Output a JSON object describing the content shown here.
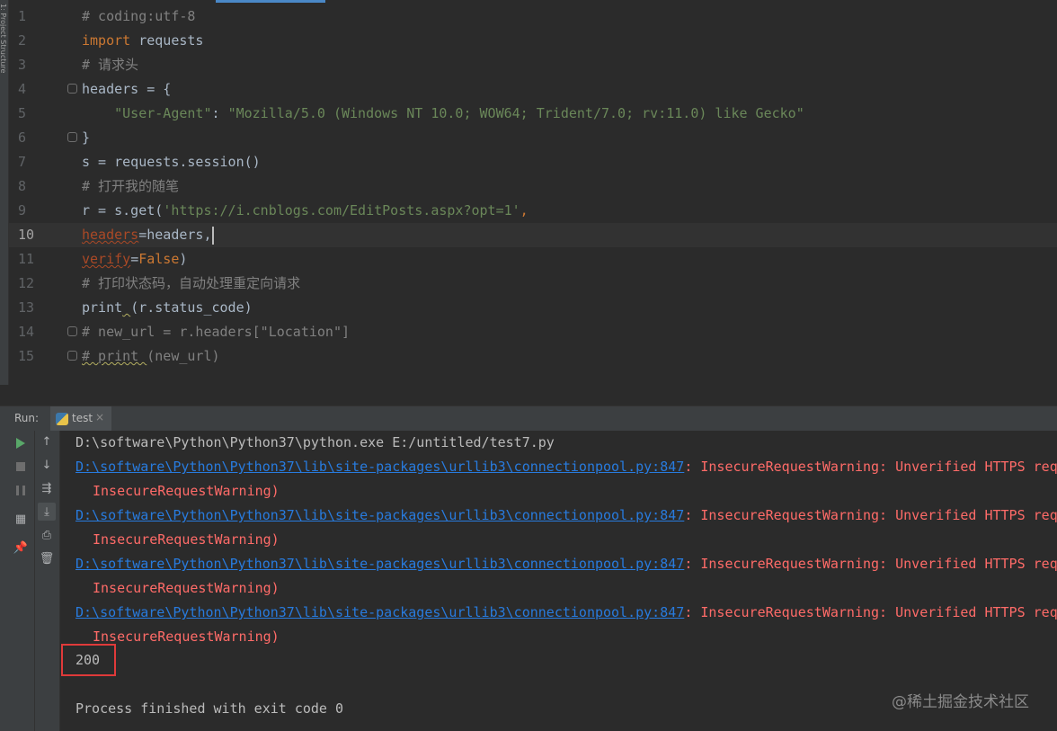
{
  "editor": {
    "side_tool_label": "1: Project  Structure",
    "line_numbers": [
      "1",
      "2",
      "3",
      "4",
      "5",
      "6",
      "7",
      "8",
      "9",
      "10",
      "11",
      "12",
      "13",
      "14",
      "15"
    ],
    "current_line_index": 9,
    "lines": [
      [
        {
          "t": "# coding:utf-8",
          "c": "c-comment"
        }
      ],
      [
        {
          "t": "import",
          "c": "c-keyword"
        },
        {
          "t": " requests",
          "c": ""
        }
      ],
      [
        {
          "t": "# 请求头",
          "c": "c-comment"
        }
      ],
      [
        {
          "t": "headers = {",
          "c": ""
        }
      ],
      [
        {
          "t": "    ",
          "c": ""
        },
        {
          "t": "\"User-Agent\"",
          "c": "c-string"
        },
        {
          "t": ": ",
          "c": ""
        },
        {
          "t": "\"Mozilla/5.0 (Windows NT 10.0; WOW64; Trident/7.0; rv:11.0) like Gecko\"",
          "c": "c-string"
        }
      ],
      [
        {
          "t": "}",
          "c": ""
        }
      ],
      [
        {
          "t": "s = requests.session()",
          "c": ""
        }
      ],
      [
        {
          "t": "# 打开我的随笔",
          "c": "c-comment"
        }
      ],
      [
        {
          "t": "r = s.get(",
          "c": ""
        },
        {
          "t": "'https://i.cnblogs.com/EditPosts.aspx?opt=1'",
          "c": "c-string"
        },
        {
          "t": ",",
          "c": "c-keyword"
        }
      ],
      [
        {
          "t": "headers",
          "c": "c-param"
        },
        {
          "t": "=headers,",
          "c": ""
        }
      ],
      [
        {
          "t": "verify",
          "c": "c-param"
        },
        {
          "t": "=",
          "c": ""
        },
        {
          "t": "False",
          "c": "c-const"
        },
        {
          "t": ")",
          "c": ""
        }
      ],
      [
        {
          "t": "# 打印状态码，自动处理重定向请求",
          "c": "c-comment"
        }
      ],
      [
        {
          "t": "print",
          "c": ""
        },
        {
          "t": " ",
          "c": "c-warn"
        },
        {
          "t": "(r.status_code)",
          "c": ""
        }
      ],
      [
        {
          "t": "# new_url = r.headers[\"Location\"]",
          "c": "c-comment"
        }
      ],
      [
        {
          "t": "# print ",
          "c": "c-comment c-warn"
        },
        {
          "t": "(new_url)",
          "c": "c-comment"
        }
      ]
    ]
  },
  "run": {
    "label": "Run:",
    "tab_label": "test",
    "tab_close": "×",
    "toolbar_icons": [
      "rerun-icon",
      "stop-icon",
      "pause-icon",
      "layout-icon",
      "pin-icon",
      "up-arrow-icon",
      "down-arrow-icon",
      "soft-wrap-icon",
      "scroll-to-end-icon",
      "print-icon",
      "trash-icon"
    ]
  },
  "console": {
    "command": "D:\\software\\Python\\Python37\\python.exe E:/untitled/test7.py",
    "warning_link": "D:\\software\\Python\\Python37\\lib\\site-packages\\urllib3\\connectionpool.py:847",
    "warning_text": ": InsecureRequestWarning: Unverified HTTPS requ",
    "warning_cont": "InsecureRequestWarning)",
    "status_code": "200",
    "finished": "Process finished with exit code 0"
  },
  "watermark": "@稀土掘金技术社区",
  "colors": {
    "accent_box": "#e03a3a",
    "link": "#287bde",
    "error": "#ff6b68",
    "background": "#2b2b2b"
  }
}
